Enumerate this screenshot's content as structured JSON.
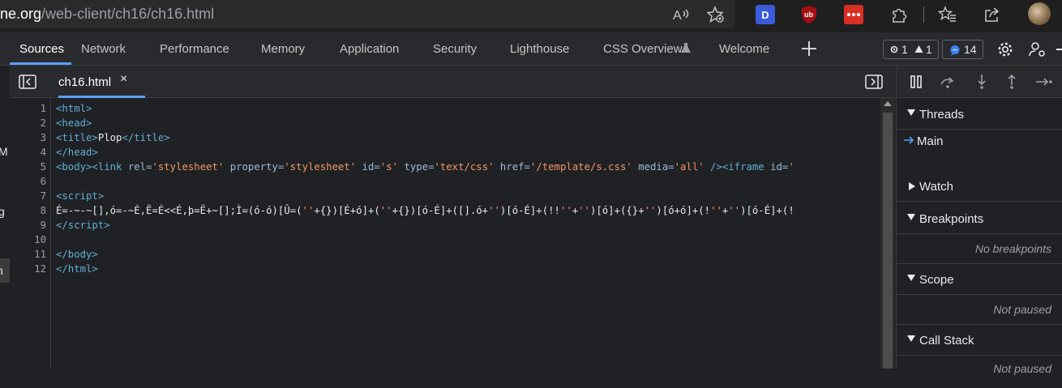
{
  "browser": {
    "url_host": "ne.org",
    "url_path": "/web-client/ch16/ch16.html",
    "extension_d_label": "D"
  },
  "devtools": {
    "tabs": [
      {
        "label": "Sources",
        "active": true
      },
      {
        "label": "Network"
      },
      {
        "label": "Performance"
      },
      {
        "label": "Memory"
      },
      {
        "label": "Application"
      },
      {
        "label": "Security"
      },
      {
        "label": "Lighthouse"
      },
      {
        "label": "CSS Overview"
      },
      {
        "label": "Welcome"
      }
    ],
    "issues": {
      "errors": "1",
      "warnings": "1"
    },
    "messages": "14"
  },
  "navigator_sliver": [
    "M",
    "g",
    "h"
  ],
  "editor": {
    "file_tab": "ch16.html",
    "line_numbers": [
      "1",
      "2",
      "3",
      "4",
      "5",
      "6",
      "7",
      "8",
      "9",
      "10",
      "11",
      "12"
    ]
  },
  "sidebar": {
    "threads": {
      "label": "Threads",
      "main": "Main"
    },
    "watch": {
      "label": "Watch"
    },
    "breakpoints": {
      "label": "Breakpoints",
      "empty": "No breakpoints"
    },
    "scope": {
      "label": "Scope",
      "empty": "Not paused"
    },
    "callstack": {
      "label": "Call Stack",
      "empty": "Not paused"
    }
  },
  "colors": {
    "accent": "#5aa0ff",
    "background": "#202124"
  }
}
